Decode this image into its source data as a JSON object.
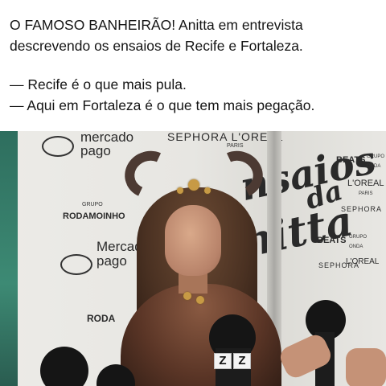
{
  "post": {
    "caption_line1": "O FAMOSO BANHEIRÃO! Anitta em entrevista",
    "caption_line2": "descrevendo os ensaios de Recife e Fortaleza.",
    "quote_line1": "— Recife é o que mais pula.",
    "quote_line2": "— Aqui em Fortaleza é o que tem mais pegação."
  },
  "media": {
    "backdrop": {
      "mercado_pago_top_1": "mercado",
      "mercado_pago_top_2": "pago",
      "sephora_loreal_top": "SEPHORA L'OREAL",
      "paris": "PARIS",
      "grupo_small": "GRUPO",
      "rodamoinho": "RODAMOINHO",
      "mercado_pago_mid_1": "Mercado",
      "mercado_pago_mid_2": "pago",
      "roda_fragment": "RODA",
      "big_title_1": "nsaios",
      "big_title_2": "da",
      "big_title_3": "nitta",
      "beats_1": "BEATS",
      "grupo_onda_1": "GRUPO ONDA",
      "loreal_right": "L'OREAL",
      "paris_right": "PARIS",
      "sephora_right": "SEPHORA",
      "beats_2": "BEATS",
      "grupo_onda_2": "GRUPO ONDA",
      "sephora_right_2": "SEPHORA",
      "loreal_right_2": "L'OREAL"
    },
    "mic_labels": [
      "Z",
      "Z"
    ]
  }
}
